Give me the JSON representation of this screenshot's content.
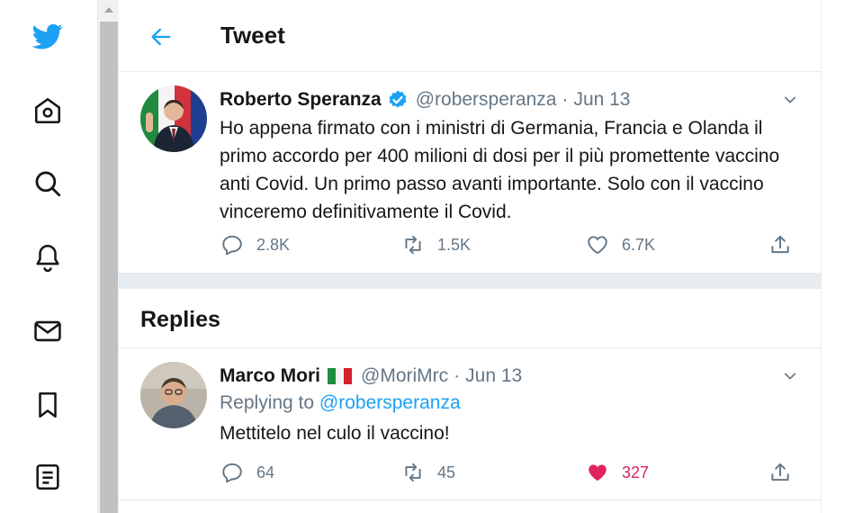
{
  "nav": {
    "items": [
      {
        "icon": "twitter-bird-icon"
      },
      {
        "icon": "home-icon"
      },
      {
        "icon": "explore-search-icon"
      },
      {
        "icon": "notifications-bell-icon"
      },
      {
        "icon": "messages-envelope-icon"
      },
      {
        "icon": "bookmarks-icon"
      },
      {
        "icon": "lists-icon"
      }
    ]
  },
  "header": {
    "title": "Tweet",
    "back_icon": "back-arrow-icon"
  },
  "tweet": {
    "author_name": "Roberto Speranza",
    "verified": true,
    "handle": "@robersperanza",
    "separator": "·",
    "date": "Jun 13",
    "text": "Ho appena firmato con i ministri di Germania, Francia e Olanda il primo accordo per 400 milioni di dosi per il più promettente vaccino anti Covid. Un primo passo avanti importante. Solo con il vaccino vinceremo definitivamente il Covid.",
    "actions": {
      "replies": "2.8K",
      "retweets": "1.5K",
      "likes": "6.7K"
    }
  },
  "replies_section": {
    "title": "Replies"
  },
  "reply": {
    "author_name": "Marco Mori",
    "flag": "italy-flag-icon",
    "handle": "@MoriMrc",
    "separator": "·",
    "date": "Jun 13",
    "replying_prefix": "Replying to",
    "replying_to": "@robersperanza",
    "text": "Mettitelo nel culo il vaccino!",
    "liked": true,
    "actions": {
      "replies": "64",
      "retweets": "45",
      "likes": "327"
    }
  },
  "colors": {
    "brand_blue": "#1da1f2",
    "like_pink": "#e0245e",
    "muted_text": "#657786",
    "divider": "#e6ecf0"
  }
}
